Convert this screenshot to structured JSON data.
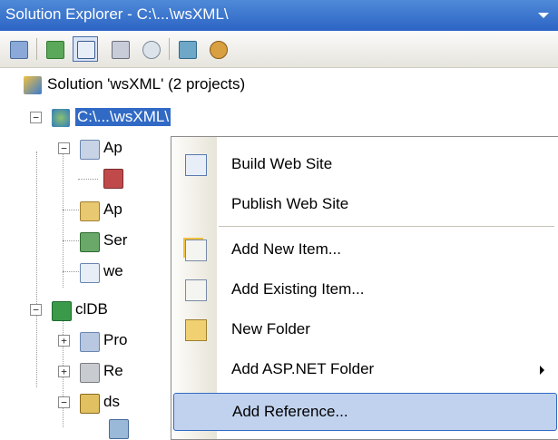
{
  "window": {
    "title": "Solution Explorer - C:\\...\\wsXML\\"
  },
  "toolbar": {
    "buttons": [
      "properties-icon",
      "refresh-icon",
      "show-all-files-icon",
      "view-code-icon",
      "nest-related-files-icon",
      "copy-website-icon",
      "asp-net-config-icon"
    ]
  },
  "tree": {
    "solution": "Solution 'wsXML' (2 projects)",
    "website": "C:\\...\\wsXML\\",
    "website_children": [
      "Ap",
      "Ap",
      "Ser",
      "we"
    ],
    "cldb": "clDB",
    "cldb_children": [
      "Pro",
      "Re",
      "ds"
    ]
  },
  "context_menu": {
    "items": [
      {
        "label": "Build Web Site",
        "icon": "build-icon"
      },
      {
        "label": "Publish Web Site",
        "icon": ""
      },
      {
        "label": "Add New Item...",
        "icon": "add-new-item-icon"
      },
      {
        "label": "Add Existing Item...",
        "icon": "add-existing-item-icon"
      },
      {
        "label": "New Folder",
        "icon": "folder-icon"
      },
      {
        "label": "Add ASP.NET Folder",
        "icon": ""
      },
      {
        "label": "Add Reference...",
        "icon": ""
      }
    ]
  }
}
